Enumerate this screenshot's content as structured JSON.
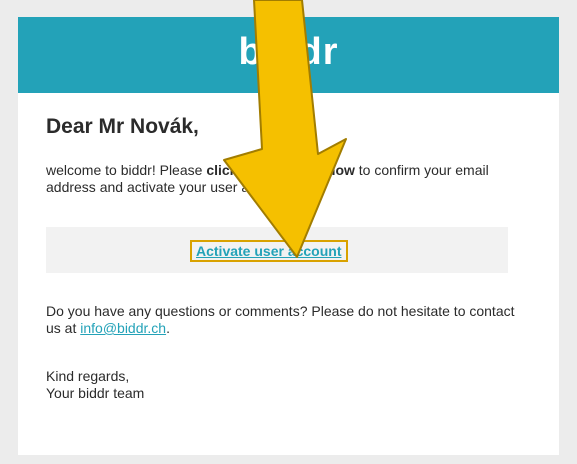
{
  "header": {
    "logo_text": "biddr",
    "brand_color": "#23a2b8"
  },
  "email": {
    "greeting": "Dear Mr Novák,",
    "intro_before": "welcome to biddr! Please ",
    "intro_bold": "click on the link below",
    "intro_after": " to confirm your email address and activate your user account:",
    "cta_label": "Activate user account",
    "questions_text": "Do you have any questions or comments? Please do not hesitate to contact us at ",
    "contact_email": "info@biddr.ch",
    "questions_end": ".",
    "regards_line1": "Kind regards,",
    "regards_line2": "Your biddr team"
  },
  "annotation": {
    "arrow_color": "#f5c000",
    "highlight_color": "#d9a200"
  }
}
